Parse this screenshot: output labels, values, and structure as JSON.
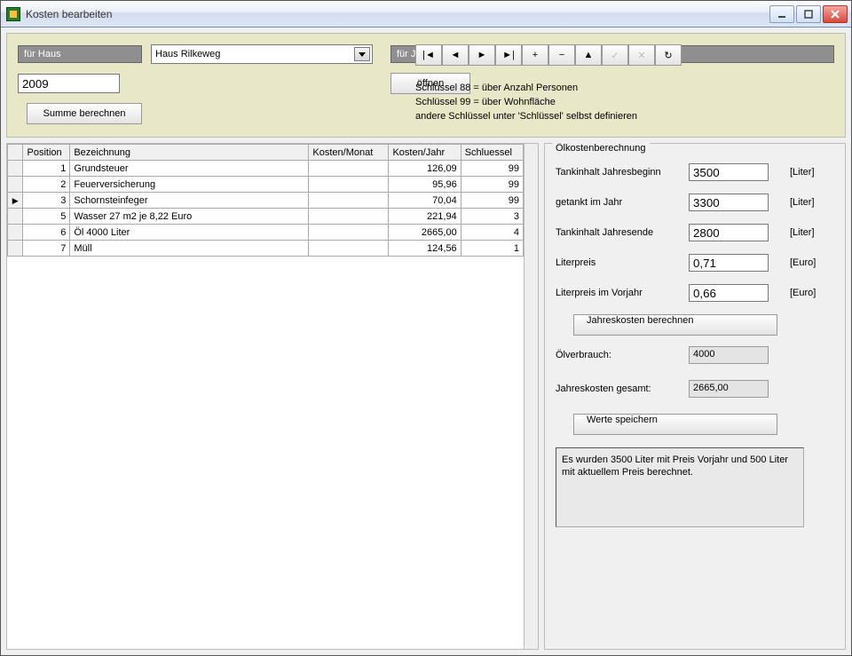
{
  "window": {
    "title": "Kosten bearbeiten"
  },
  "topform": {
    "house_label": "für Haus",
    "house_value": "Haus Rilkeweg",
    "year_label": "für Jahr",
    "year_value": "2009",
    "open_button": "öffnen",
    "sum_button": "Summe berechnen",
    "hint_line1": "Schlüssel 88 = über Anzahl Personen",
    "hint_line2": "Schlüssel 99 = über Wohnfläche",
    "hint_line3": "andere Schlüssel unter 'Schlüssel' selbst definieren"
  },
  "nav": {
    "first": "|◄",
    "prev": "◄",
    "next": "►",
    "last": "►|",
    "add": "+",
    "del": "−",
    "edit": "▲",
    "post": "✓",
    "cancel": "✕",
    "refresh": "↻"
  },
  "grid": {
    "headers": {
      "position": "Position",
      "bezeichnung": "Bezeichnung",
      "kosten_monat": "Kosten/Monat",
      "kosten_jahr": "Kosten/Jahr",
      "schluessel": "Schluessel"
    },
    "rows": [
      {
        "marker": "",
        "position": "1",
        "bezeichnung": "Grundsteuer",
        "kosten_monat": "",
        "kosten_jahr": "126,09",
        "schluessel": "99"
      },
      {
        "marker": "",
        "position": "2",
        "bezeichnung": "Feuerversicherung",
        "kosten_monat": "",
        "kosten_jahr": "95,96",
        "schluessel": "99"
      },
      {
        "marker": "▶",
        "position": "3",
        "bezeichnung": "Schornsteinfeger",
        "kosten_monat": "",
        "kosten_jahr": "70,04",
        "schluessel": "99"
      },
      {
        "marker": "",
        "position": "5",
        "bezeichnung": "Wasser 27 m2 je 8,22 Euro",
        "kosten_monat": "",
        "kosten_jahr": "221,94",
        "schluessel": "3"
      },
      {
        "marker": "",
        "position": "6",
        "bezeichnung": "Öl 4000 Liter",
        "kosten_monat": "",
        "kosten_jahr": "2665,00",
        "schluessel": "4"
      },
      {
        "marker": "",
        "position": "7",
        "bezeichnung": "Müll",
        "kosten_monat": "",
        "kosten_jahr": "124,56",
        "schluessel": "1"
      }
    ]
  },
  "oil": {
    "group_title": "Ölkostenberechnung",
    "tank_start_label": "Tankinhalt Jahresbeginn",
    "tank_start_value": "3500",
    "tanked_label": "getankt im Jahr",
    "tanked_value": "3300",
    "tank_end_label": "Tankinhalt Jahresende",
    "tank_end_value": "2800",
    "liter_unit": "[Liter]",
    "price_label": "Literpreis",
    "price_value": "0,71",
    "price_prev_label": "Literpreis im Vorjahr",
    "price_prev_value": "0,66",
    "euro_unit": "[Euro]",
    "calc_button": "Jahreskosten berechnen",
    "consumption_label": "Ölverbrauch:",
    "consumption_value": "4000",
    "total_label": "Jahreskosten gesamt:",
    "total_value": "2665,00",
    "save_button": "Werte speichern",
    "message": "Es wurden 3500 Liter mit Preis Vorjahr und 500 Liter mit aktuellem Preis berechnet."
  }
}
